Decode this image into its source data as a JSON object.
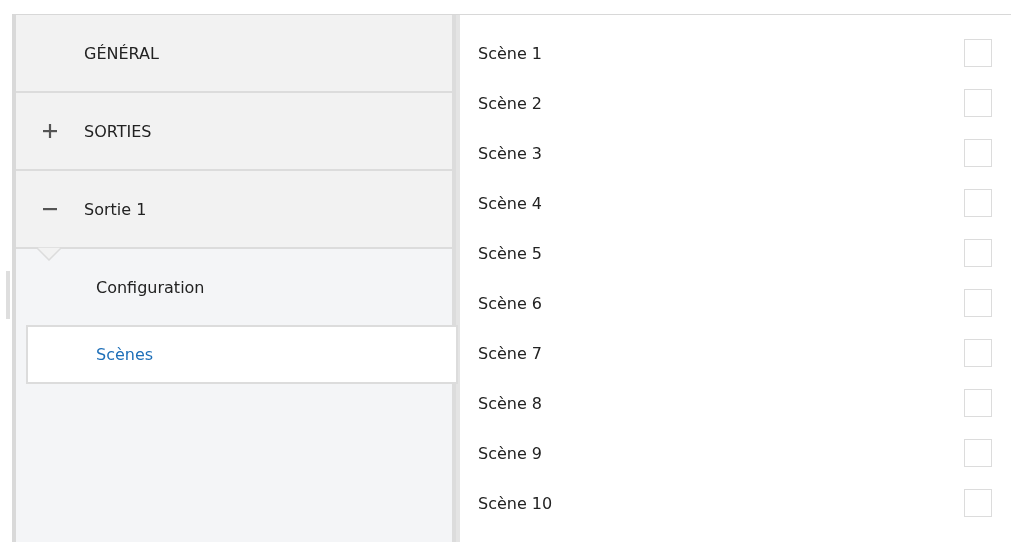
{
  "sidebar": {
    "items": [
      {
        "kind": "page",
        "label": "GÉNÉRAL"
      },
      {
        "kind": "group",
        "label": "SORTIES",
        "expanded": false
      },
      {
        "kind": "group",
        "label": "Sortie 1",
        "expanded": true,
        "children": [
          {
            "label": "Configuration",
            "selected": false
          },
          {
            "label": "Scènes",
            "selected": true
          }
        ]
      }
    ]
  },
  "scenes": [
    {
      "label": "Scène 1",
      "checked": false
    },
    {
      "label": "Scène 2",
      "checked": false
    },
    {
      "label": "Scène 3",
      "checked": false
    },
    {
      "label": "Scène 4",
      "checked": false
    },
    {
      "label": "Scène 5",
      "checked": false
    },
    {
      "label": "Scène 6",
      "checked": false
    },
    {
      "label": "Scène 7",
      "checked": false
    },
    {
      "label": "Scène 8",
      "checked": false
    },
    {
      "label": "Scène 9",
      "checked": false
    },
    {
      "label": "Scène 10",
      "checked": false
    }
  ]
}
